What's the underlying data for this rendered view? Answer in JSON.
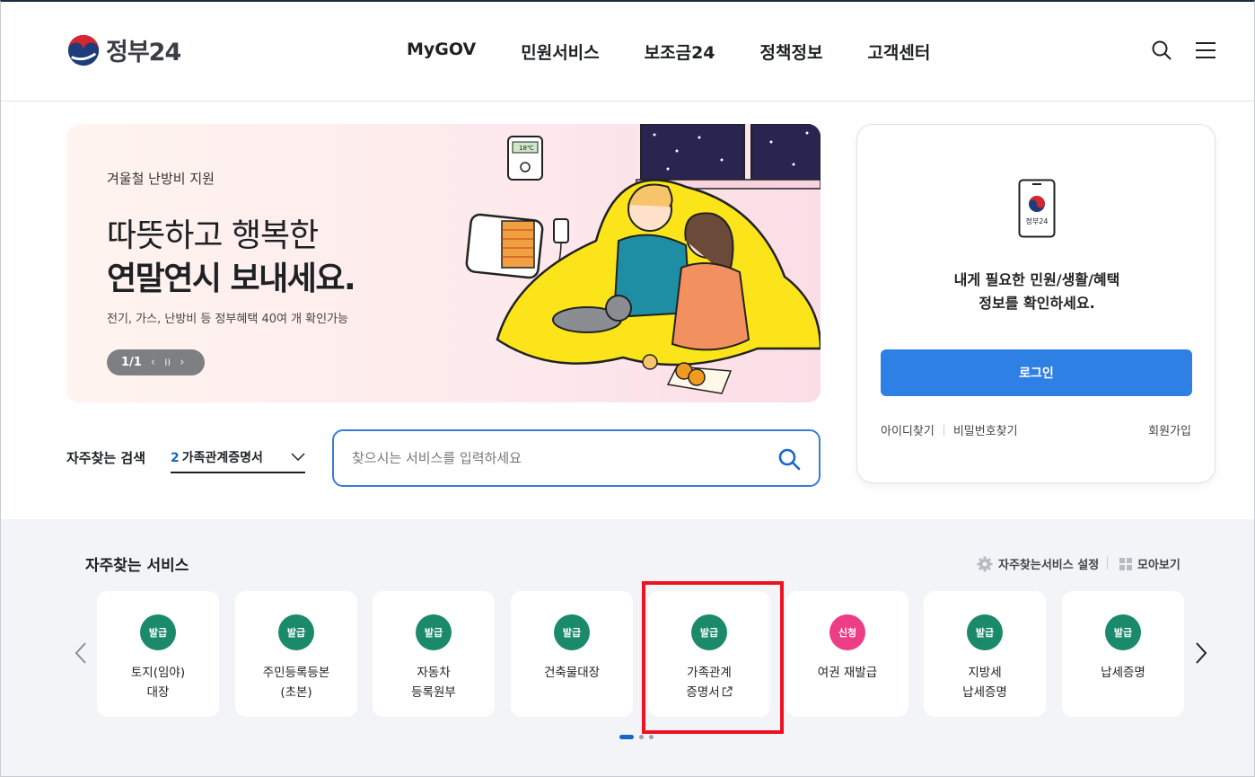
{
  "header": {
    "logo_text": "정부24",
    "nav": [
      "MyGOV",
      "민원서비스",
      "보조금24",
      "정책정보",
      "고객센터"
    ],
    "icons": [
      "search-icon",
      "menu-icon"
    ]
  },
  "banner": {
    "subtitle": "겨울철 난방비 지원",
    "title_line1": "따뜻하고 행복한",
    "title_line2": "연말연시 보내세요.",
    "description": "전기, 가스, 난방비 등 정부혜택 40여 개 확인가능",
    "pager": "1/1",
    "prev_symbol": "‹",
    "pause_symbol": "ıı",
    "next_symbol": "›",
    "thermostat_reading": "18℃"
  },
  "search": {
    "label": "자주찾는 검색",
    "selected_rank": "2",
    "selected_term": "가족관계증명서",
    "placeholder": "찾으시는 서비스를 입력하세요"
  },
  "login": {
    "phone_label": "정부24",
    "message_line1": "내게 필요한 민원/생활/혜택",
    "message_line2": "정보를 확인하세요.",
    "login_button": "로그인",
    "find_id": "아이디찾기",
    "find_password": "비밀번호찾기",
    "signup": "회원가입"
  },
  "services": {
    "title": "자주찾는 서비스",
    "settings_label": "자주찾는서비스 설정",
    "view_all_label": "모아보기",
    "items": [
      {
        "badge": "발급",
        "type": "issue",
        "line1": "토지(임야)",
        "line2": "대장"
      },
      {
        "badge": "발급",
        "type": "issue",
        "line1": "주민등록등본",
        "line2": "(초본)"
      },
      {
        "badge": "발급",
        "type": "issue",
        "line1": "자동차",
        "line2": "등록원부"
      },
      {
        "badge": "발급",
        "type": "issue",
        "line1": "건축물대장",
        "line2": ""
      },
      {
        "badge": "발급",
        "type": "issue",
        "line1": "가족관계",
        "line2": "증명서"
      },
      {
        "badge": "신청",
        "type": "apply",
        "line1": "여권 재발급",
        "line2": ""
      },
      {
        "badge": "발급",
        "type": "issue",
        "line1": "지방세",
        "line2": "납세증명"
      },
      {
        "badge": "발급",
        "type": "issue",
        "line1": "납세증명",
        "line2": ""
      }
    ],
    "pagination": {
      "pages": 3,
      "current": 1
    }
  },
  "colors": {
    "primary_blue": "#2f80e5",
    "issue_badge": "#1a8a6a",
    "apply_badge": "#ec3d86",
    "highlight_red": "#ee1122"
  }
}
